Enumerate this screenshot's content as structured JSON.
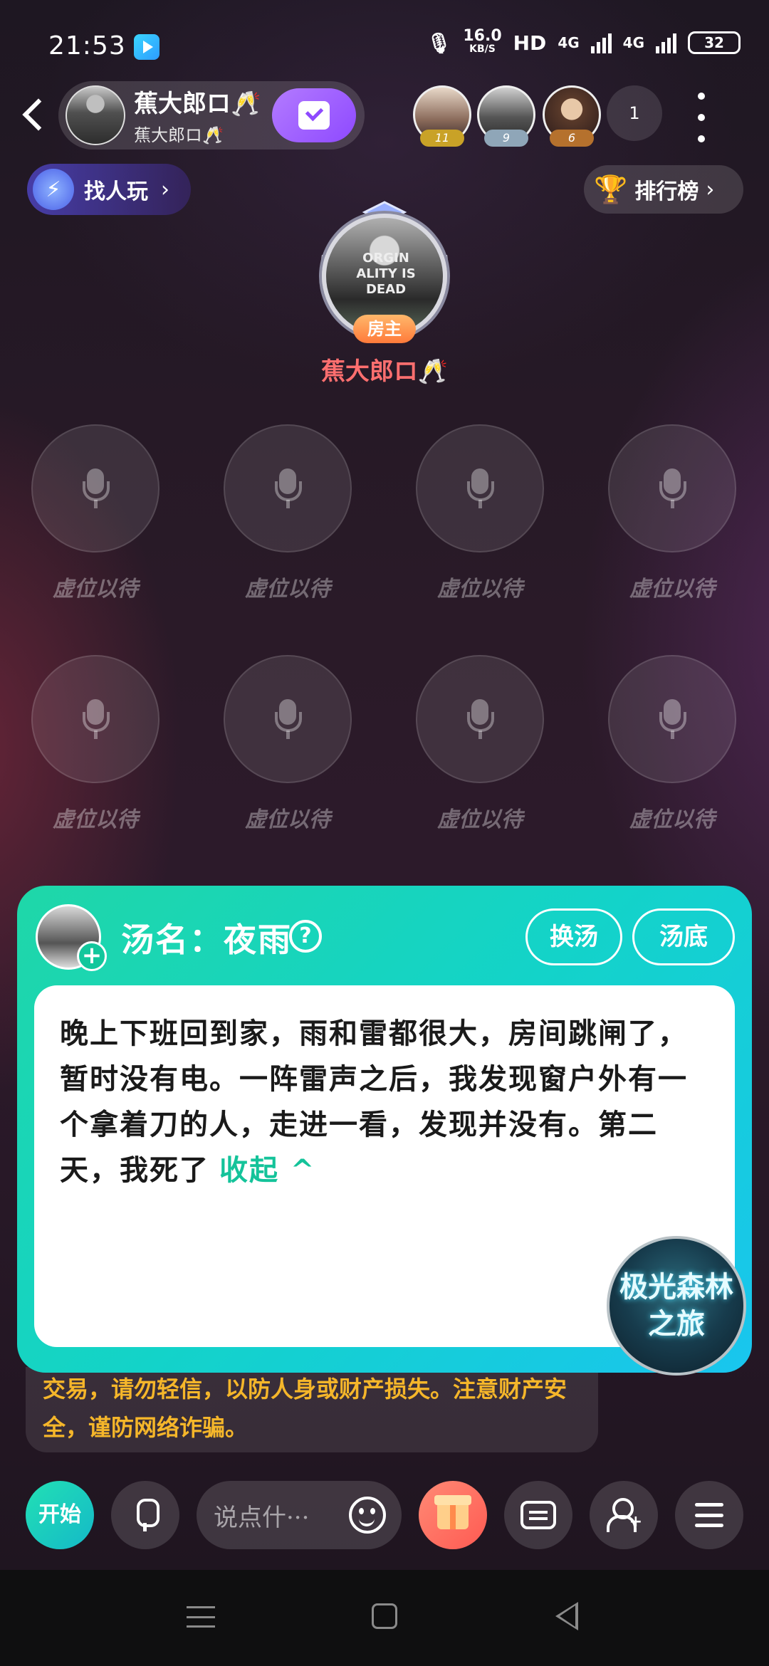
{
  "status_bar": {
    "time": "21:53",
    "speed_value": "16.0",
    "speed_unit": "KB/S",
    "hd_label": "HD",
    "net1": "4G",
    "net2": "4G",
    "battery": "32"
  },
  "header": {
    "room_name": "蕉大郎ロ🥂",
    "room_sub": "蕉大郎ロ🥂",
    "rank_avatars": [
      {
        "badge": "11",
        "badge_color": "#c9a227"
      },
      {
        "badge": "9",
        "badge_color": "#8fa6b8"
      },
      {
        "badge": "6",
        "badge_color": "#b5712d"
      }
    ],
    "online_count": "1"
  },
  "find_people": {
    "label": "找人玩"
  },
  "leaderboard": {
    "label": "排行榜"
  },
  "host": {
    "badge": "房主",
    "name": "蕉大郎ロ🥂",
    "avatar_text": "ORGIN ALITY IS DEAD"
  },
  "seats": [
    {
      "label": "虚位以待"
    },
    {
      "label": "虚位以待"
    },
    {
      "label": "虚位以待"
    },
    {
      "label": "虚位以待"
    },
    {
      "label": "虚位以待"
    },
    {
      "label": "虚位以待"
    },
    {
      "label": "虚位以待"
    },
    {
      "label": "虚位以待"
    }
  ],
  "soup_card": {
    "title": "汤名：夜雨",
    "help": "?",
    "change_button": "换汤",
    "answer_button": "汤底",
    "story": "晚上下班回到家，雨和雷都很大，房间跳闸了，暂时没有电。一阵雷声之后，我发现窗户外有一个拿着刀的人，走进一看，发现并没有。第二天，我死了",
    "collapse_label": "收起 ^",
    "theme_line1": "极光森林",
    "theme_line2": "之旅"
  },
  "notice": {
    "text": "交易，请勿轻信，以防人身或财产损失。注意财产安全，谨防网络诈骗。"
  },
  "toolbar": {
    "start_label": "开始",
    "chat_placeholder": "说点什···"
  },
  "colors": {
    "accent_teal": "#13d3c9",
    "notice_yellow": "#f5b62a",
    "host_name_red": "#ff6f6f",
    "gift_red": "#ff5a52"
  }
}
